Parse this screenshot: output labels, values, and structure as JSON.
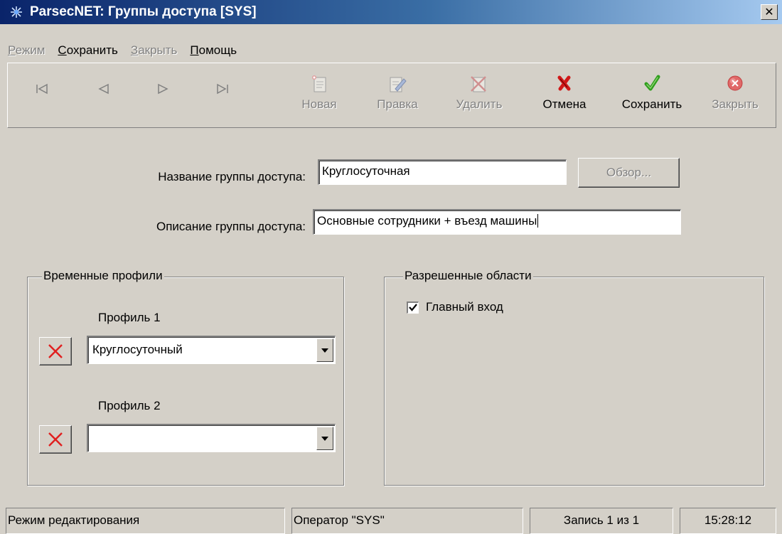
{
  "window": {
    "title": "ParsecNET: Группы доступа [SYS]",
    "close_glyph": "✕"
  },
  "menu": {
    "items": [
      {
        "label": "Режим",
        "accel": "Р",
        "rest": "ежим",
        "enabled": false
      },
      {
        "label": "Сохранить",
        "accel": "С",
        "rest": "охранить",
        "enabled": true
      },
      {
        "label": "Закрыть",
        "accel": "З",
        "rest": "акрыть",
        "enabled": false
      },
      {
        "label": "Помощь",
        "accel": "П",
        "rest": "омощь",
        "enabled": true
      }
    ]
  },
  "toolbar": {
    "nav": [
      {
        "name": "first-record-icon",
        "enabled": false
      },
      {
        "name": "prev-record-icon",
        "enabled": false
      },
      {
        "name": "next-record-icon",
        "enabled": false
      },
      {
        "name": "last-record-icon",
        "enabled": false
      }
    ],
    "buttons": [
      {
        "label": "Новая",
        "icon": "new-record-icon",
        "enabled": false
      },
      {
        "label": "Правка",
        "icon": "edit-icon",
        "enabled": false
      },
      {
        "label": "Удалить",
        "icon": "delete-record-icon",
        "enabled": false
      },
      {
        "label": "Отмена",
        "icon": "cancel-icon",
        "enabled": true
      },
      {
        "label": "Сохранить",
        "icon": "save-check-icon",
        "enabled": true
      },
      {
        "label": "Закрыть",
        "icon": "close-circle-icon",
        "enabled": false
      }
    ]
  },
  "form": {
    "name_label": "Название группы доступа:",
    "name_value": "Круглосуточная",
    "browse_label": "Обзор...",
    "desc_label": "Описание группы доступа:",
    "desc_value": "Основные сотрудники + въезд машины"
  },
  "profiles": {
    "title": "Временные профили",
    "items": [
      {
        "label": "Профиль 1",
        "value": "Круглосуточный"
      },
      {
        "label": "Профиль 2",
        "value": ""
      }
    ]
  },
  "areas": {
    "title": "Разрешенные области",
    "items": [
      {
        "label": "Главный вход",
        "checked": true
      }
    ]
  },
  "status": {
    "mode": "Режим редактирования",
    "operator": "Оператор \"SYS\"",
    "record": "Запись 1 из 1",
    "time": "15:28:12"
  },
  "colors": {
    "title_start": "#0a246a",
    "title_end": "#a6caf0",
    "face": "#d4d0c8",
    "cancel_red": "#d01818",
    "save_green": "#2e9e1c"
  }
}
